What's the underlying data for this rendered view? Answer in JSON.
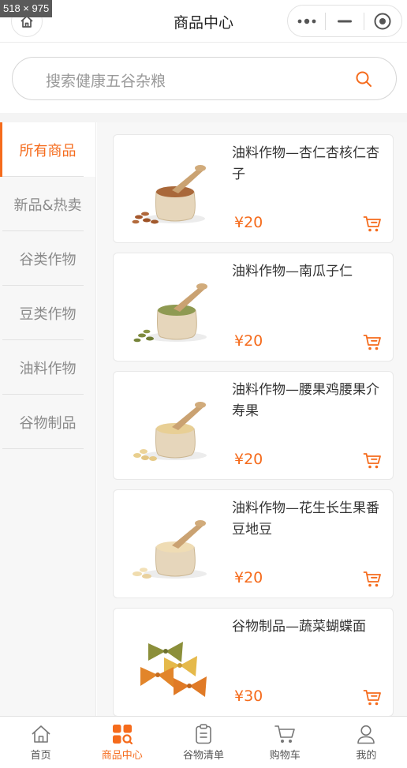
{
  "overlay": {
    "dimensions_label": "518 × 975"
  },
  "header": {
    "title": "商品中心"
  },
  "search": {
    "placeholder": "搜索健康五谷杂粮"
  },
  "sidebar": {
    "items": [
      {
        "label": "所有商品",
        "active": true
      },
      {
        "label": "新品&热卖",
        "active": false
      },
      {
        "label": "谷类作物",
        "active": false
      },
      {
        "label": "豆类作物",
        "active": false
      },
      {
        "label": "油料作物",
        "active": false
      },
      {
        "label": "谷物制品",
        "active": false
      }
    ]
  },
  "products": [
    {
      "name": "油料作物—杏仁杏核仁杏子",
      "price": "¥20",
      "image": "almond-sack"
    },
    {
      "name": "油料作物—南瓜子仁",
      "price": "¥20",
      "image": "pumpkin-seed-sack"
    },
    {
      "name": "油料作物—腰果鸡腰果介寿果",
      "price": "¥20",
      "image": "cashew-sack"
    },
    {
      "name": "油料作物—花生长生果番豆地豆",
      "price": "¥20",
      "image": "peanut-sack"
    },
    {
      "name": "谷物制品—蔬菜蝴蝶面",
      "price": "¥30",
      "image": "farfalle-pasta"
    }
  ],
  "tabbar": {
    "items": [
      {
        "label": "首页",
        "icon": "home-icon",
        "active": false
      },
      {
        "label": "商品中心",
        "icon": "grid-icon",
        "active": true
      },
      {
        "label": "谷物清单",
        "icon": "clipboard-icon",
        "active": false
      },
      {
        "label": "购物车",
        "icon": "cart-icon",
        "active": false
      },
      {
        "label": "我的",
        "icon": "user-icon",
        "active": false
      }
    ]
  },
  "colors": {
    "accent": "#f56b1c",
    "text": "#333333",
    "muted": "#8a8a8a",
    "background": "#f7f7f7"
  }
}
